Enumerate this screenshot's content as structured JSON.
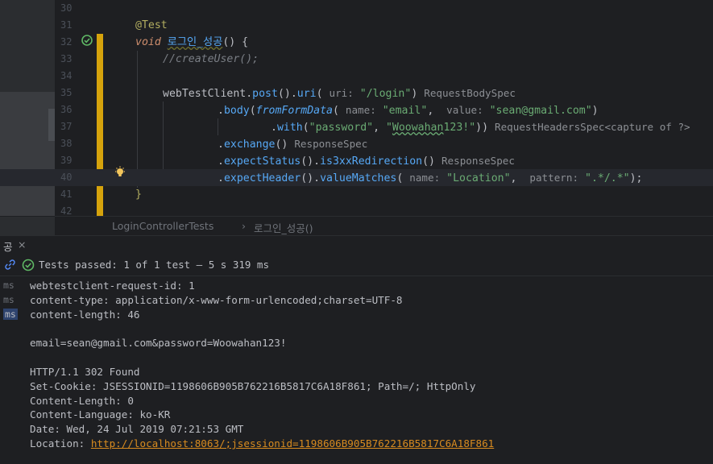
{
  "editor": {
    "lines": [
      {
        "num": "30"
      },
      {
        "num": "31",
        "annotation": "@Test"
      },
      {
        "num": "32",
        "kw": "void",
        "method": "로그인_성공",
        "rest": "() {"
      },
      {
        "num": "33",
        "comment": "//createUser();"
      },
      {
        "num": "34"
      },
      {
        "num": "35",
        "a": "webTestClient",
        "b": ".",
        "c": "post",
        "d": "().",
        "e": "uri",
        "f": "(",
        "hint1": "uri:",
        "str1": "\"/login\"",
        "g": ")",
        "type": "RequestBodySpec"
      },
      {
        "num": "36",
        "a": ".",
        "b": "body",
        "c": "(",
        "d": "fromFormData",
        "e": "(",
        "hint1": "name:",
        "str1": "\"email\"",
        "f": ",",
        "hint2": "value:",
        "str2": "\"sean@gmail.com\"",
        "g": ")"
      },
      {
        "num": "37",
        "a": ".",
        "b": "with",
        "c": "(",
        "str1": "\"password\"",
        "d": ", ",
        "str2a": "\"",
        "str2b": "Woowahan",
        "str2c": "123!\"",
        "e": "))",
        "type": "RequestHeadersSpec<capture of ?>"
      },
      {
        "num": "38",
        "a": ".",
        "b": "exchange",
        "c": "()",
        "type": "ResponseSpec"
      },
      {
        "num": "39",
        "a": ".",
        "b": "expectStatus",
        "c": "().",
        "d": "is3xxRedirection",
        "e": "()",
        "type": "ResponseSpec"
      },
      {
        "num": "40",
        "a": ".",
        "b": "expectHeader",
        "c": "().",
        "d": "valueMatches",
        "e": "(",
        "hint1": "name:",
        "str1": "\"Location\"",
        "f": ",",
        "hint2": "pattern:",
        "str2": "\".*/.*\"",
        "g": ");"
      },
      {
        "num": "41",
        "brace": "}"
      },
      {
        "num": "42"
      }
    ],
    "breadcrumb": {
      "cls": "LoginControllerTests",
      "sep": "›",
      "method": "로그인_성공()"
    }
  },
  "tool_window": {
    "tab_label": "공",
    "close_label": "×",
    "status": "Tests passed: 1 of 1 test – 5 s 319 ms"
  },
  "console": {
    "ms_labels": [
      "ms",
      "ms",
      "ms"
    ],
    "lines": [
      "webtestclient-request-id: 1",
      "content-type: application/x-www-form-urlencoded;charset=UTF-8",
      "content-length: 46",
      "",
      "email=sean@gmail.com&password=Woowahan123!",
      "",
      "HTTP/1.1 302 Found",
      "Set-Cookie: JSESSIONID=1198606B905B762216B5817C6A18F861; Path=/; HttpOnly",
      "Content-Length: 0",
      "Content-Language: ko-KR",
      "Date: Wed, 24 Jul 2019 07:21:53 GMT"
    ],
    "location_label": "Location: ",
    "location_link": "http://localhost:8063/;jsessionid=1198606B905B762216B5817C6A18F861"
  },
  "colors": {
    "accent_yellow": "#d6a30c",
    "pass_green": "#5fb865",
    "link": "#d88b1f"
  }
}
